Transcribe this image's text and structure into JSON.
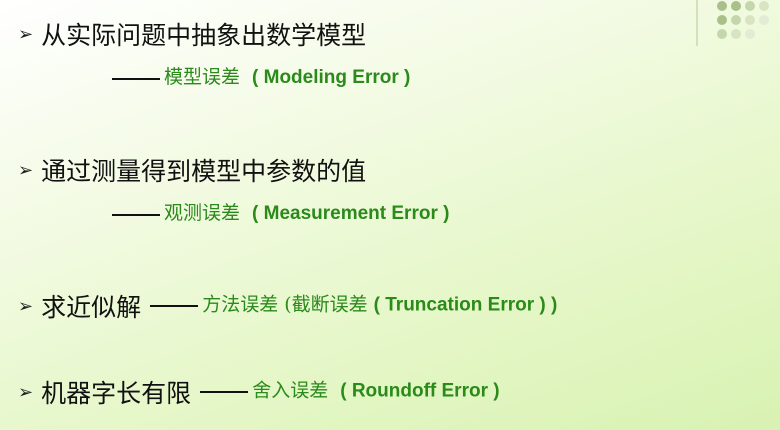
{
  "items": [
    {
      "bullet": "➢",
      "text": "从实际问题中抽象出数学模型",
      "sub": {
        "dash": "——",
        "zh": "模型误差",
        "en": "( Modeling Error )"
      }
    },
    {
      "bullet": "➢",
      "text": "通过测量得到模型中参数的值",
      "sub": {
        "dash": "——",
        "zh": "观测误差",
        "en": "( Measurement Error )"
      }
    },
    {
      "bullet": "➢",
      "text": "求近似解",
      "dash": "——",
      "zh": "方法误差",
      "zh2": "(截断误差",
      "en": "( Truncation Error ) )"
    },
    {
      "bullet": "➢",
      "text": "机器字长有限",
      "dash": "——",
      "zh": "舍入误差",
      "en": "( Roundoff  Error )"
    }
  ],
  "colors": {
    "green": "#2a8a1a",
    "text": "#111111",
    "deco": "#bdd49a"
  }
}
